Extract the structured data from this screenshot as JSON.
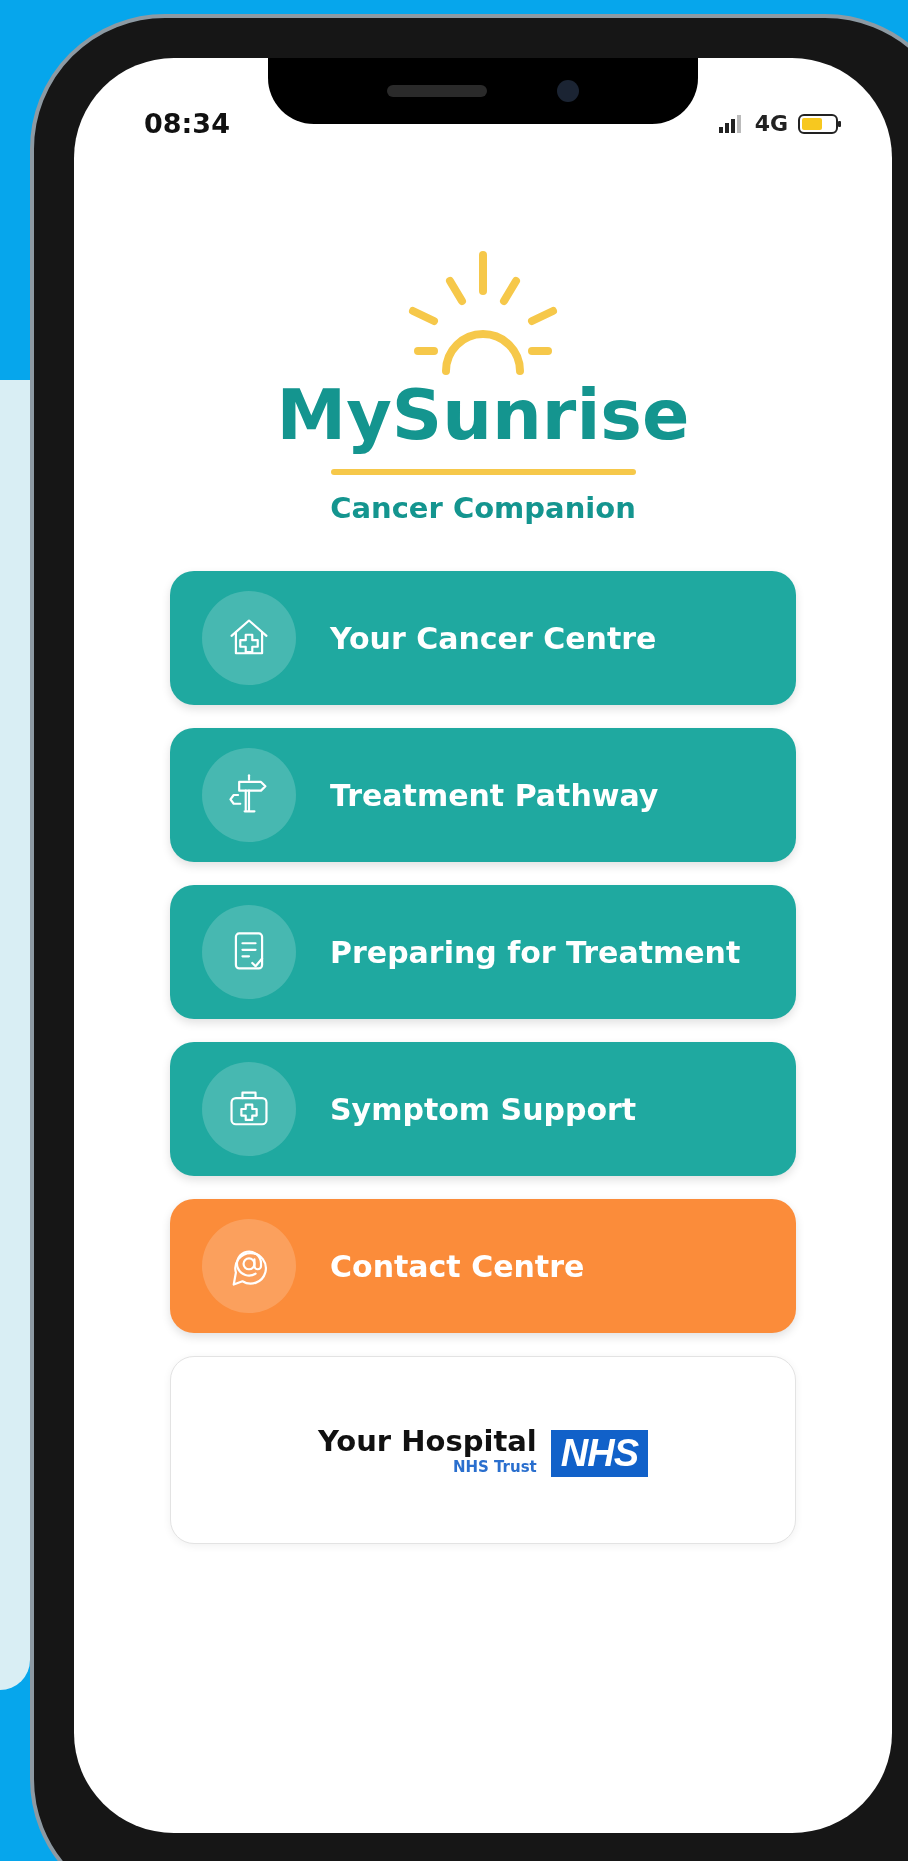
{
  "status_bar": {
    "time": "08:34",
    "network": "4G"
  },
  "logo": {
    "title": "MySunrise",
    "subtitle": "Cancer Companion"
  },
  "menu": [
    {
      "label": "Your Cancer Centre",
      "color": "#1fa9a0"
    },
    {
      "label": "Treatment Pathway",
      "color": "#1fa9a0"
    },
    {
      "label": "Preparing for Treatment",
      "color": "#1fa9a0"
    },
    {
      "label": "Symptom Support",
      "color": "#1fa9a0"
    },
    {
      "label": "Contact Centre",
      "color": "#fb8c3a"
    }
  ],
  "hospital": {
    "name": "Your Hospital",
    "trust": "NHS Trust",
    "badge": "NHS"
  }
}
